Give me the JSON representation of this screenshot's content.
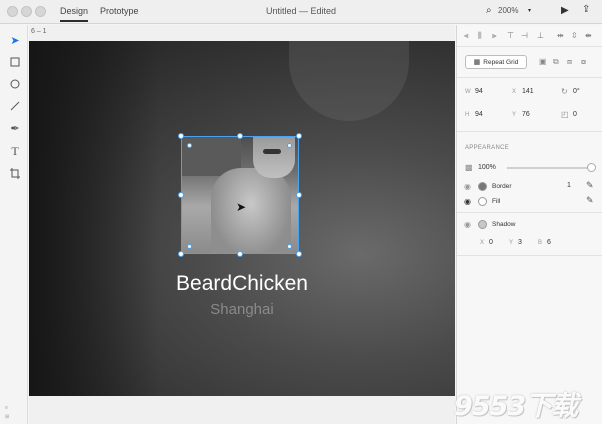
{
  "window": {
    "title": "Untitled — Edited",
    "tabs": [
      "Design",
      "Prototype"
    ],
    "active_tab": "Design",
    "zoom": "200%"
  },
  "canvas": {
    "artboard_label": "6 – 1",
    "name_text": "BeardChicken",
    "city_text": "Shanghai"
  },
  "panel": {
    "repeat_grid_label": "Repeat Grid",
    "w_label": "W",
    "w_value": "94",
    "x_label": "X",
    "x_value": "141",
    "rotation_value": "0°",
    "h_label": "H",
    "h_value": "94",
    "y_label": "Y",
    "y_value": "76",
    "radius_value": "0",
    "appearance_title": "APPEARANCE",
    "opacity_value": "100%",
    "border_label": "Border",
    "border_value": "1",
    "fill_label": "Fill",
    "shadow_label": "Shadow",
    "shadow_x_label": "X",
    "shadow_x_value": "0",
    "shadow_y_label": "Y",
    "shadow_y_value": "3",
    "shadow_b_label": "B",
    "shadow_b_value": "6"
  },
  "colors": {
    "selection": "#4aa3f0",
    "border_swatch": "#777777",
    "fill_swatch": "#ffffff",
    "shadow_swatch": "#c8c8c8"
  },
  "watermark": "9553下载"
}
